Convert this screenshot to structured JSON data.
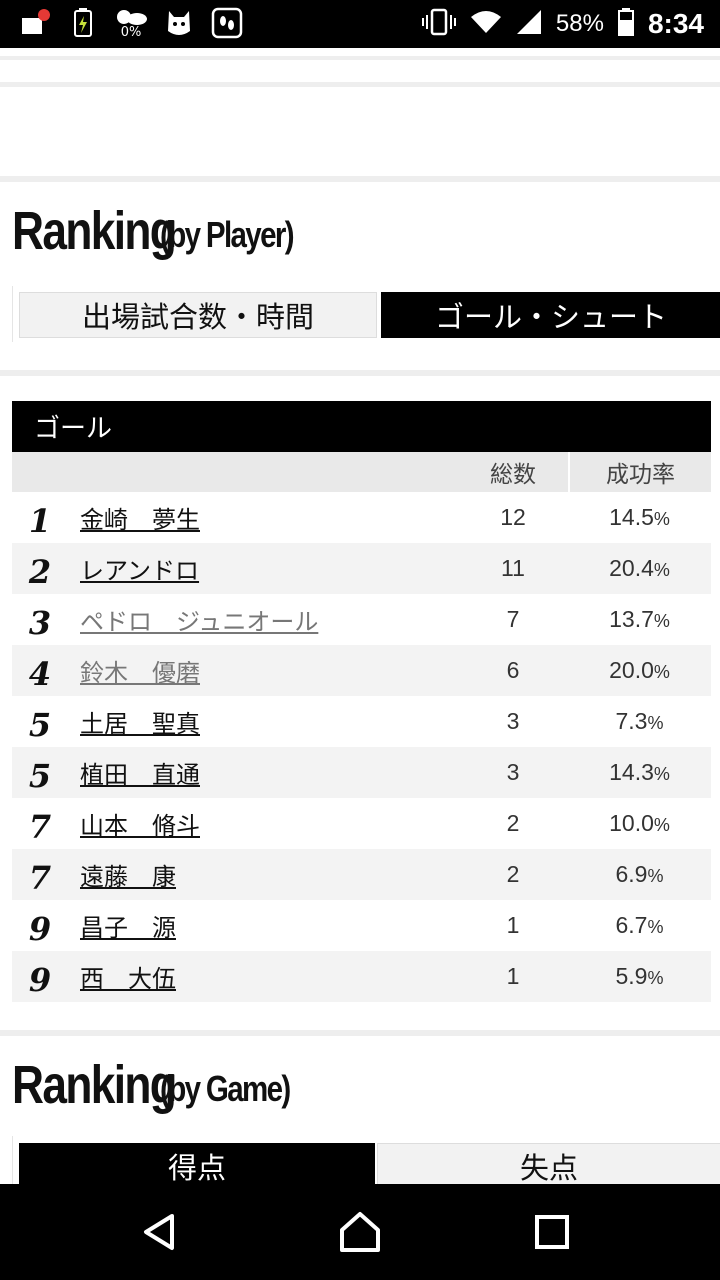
{
  "status_bar": {
    "left_icons": [
      "notification-dot-icon",
      "battery-saver-icon",
      "weather-icon",
      "app-mascot-icon",
      "footprint-app-icon"
    ],
    "weather_pct": "0%",
    "battery_pct": "58%",
    "time": "8:34"
  },
  "player_ranking": {
    "heading_main": "Ranking",
    "heading_sub": "(by Player)",
    "tabs": [
      {
        "label": "出場試合数・時間",
        "active": false
      },
      {
        "label": "ゴール・シュート",
        "active": true
      }
    ]
  },
  "goal_table": {
    "title": "ゴール",
    "columns": [
      "",
      "",
      "総数",
      "成功率"
    ],
    "rows": [
      {
        "rank": "1",
        "name": "金崎　夢生",
        "total": "12",
        "rate": "14.5",
        "unit": "%",
        "visited": false
      },
      {
        "rank": "2",
        "name": "レアンドロ",
        "total": "11",
        "rate": "20.4",
        "unit": "%",
        "visited": false
      },
      {
        "rank": "3",
        "name": "ペドロ　ジュニオール",
        "total": "7",
        "rate": "13.7",
        "unit": "%",
        "visited": true
      },
      {
        "rank": "4",
        "name": "鈴木　優磨",
        "total": "6",
        "rate": "20.0",
        "unit": "%",
        "visited": true
      },
      {
        "rank": "5",
        "name": "土居　聖真",
        "total": "3",
        "rate": "7.3",
        "unit": "%",
        "visited": false
      },
      {
        "rank": "5",
        "name": "植田　直通",
        "total": "3",
        "rate": "14.3",
        "unit": "%",
        "visited": false
      },
      {
        "rank": "7",
        "name": "山本　脩斗",
        "total": "2",
        "rate": "10.0",
        "unit": "%",
        "visited": false
      },
      {
        "rank": "7",
        "name": "遠藤　康",
        "total": "2",
        "rate": "6.9",
        "unit": "%",
        "visited": false
      },
      {
        "rank": "9",
        "name": "昌子　源",
        "total": "1",
        "rate": "6.7",
        "unit": "%",
        "visited": false
      },
      {
        "rank": "9",
        "name": "西　大伍",
        "total": "1",
        "rate": "5.9",
        "unit": "%",
        "visited": false
      }
    ]
  },
  "game_ranking": {
    "heading_main": "Ranking",
    "heading_sub": "(by Game)",
    "tabs": [
      {
        "label": "得点",
        "active": true
      },
      {
        "label": "失点",
        "active": false
      }
    ]
  },
  "nav_bar": {
    "buttons": [
      "back-icon",
      "home-icon",
      "recents-icon"
    ]
  },
  "colors": {
    "active_tab": "#000000",
    "inactive_tab": "#f2f2f2",
    "table_header": "#e9e9e9",
    "row_alt": "#f3f3f3",
    "visited_link": "#777777"
  }
}
